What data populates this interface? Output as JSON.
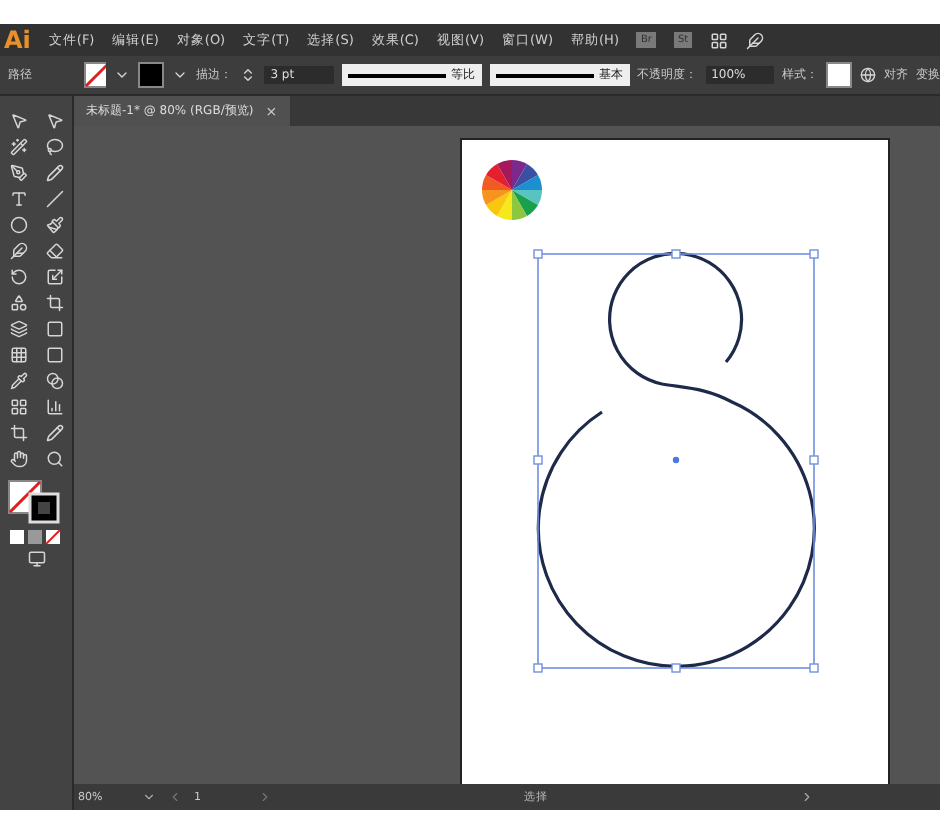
{
  "app": {
    "logo": "Ai"
  },
  "menu": [
    "文件(F)",
    "编辑(E)",
    "对象(O)",
    "文字(T)",
    "选择(S)",
    "效果(C)",
    "视图(V)",
    "窗口(W)",
    "帮助(H)"
  ],
  "menu_badges": [
    "Br",
    "St"
  ],
  "control_bar": {
    "selection_label": "路径",
    "stroke_label": "描边：",
    "stroke_weight": "3 pt",
    "profile_1": "等比",
    "profile_2": "基本",
    "opacity_label": "不透明度：",
    "opacity": "100%",
    "style_label": "样式：",
    "link_1": "对齐",
    "link_2": "变换"
  },
  "document_tabs": [
    {
      "title": "未标题-1* @ 80% (RGB/预览)",
      "selected": true,
      "close": "×"
    }
  ],
  "status_bar": {
    "zoom": "80%",
    "page": "1",
    "tool": "选择"
  }
}
